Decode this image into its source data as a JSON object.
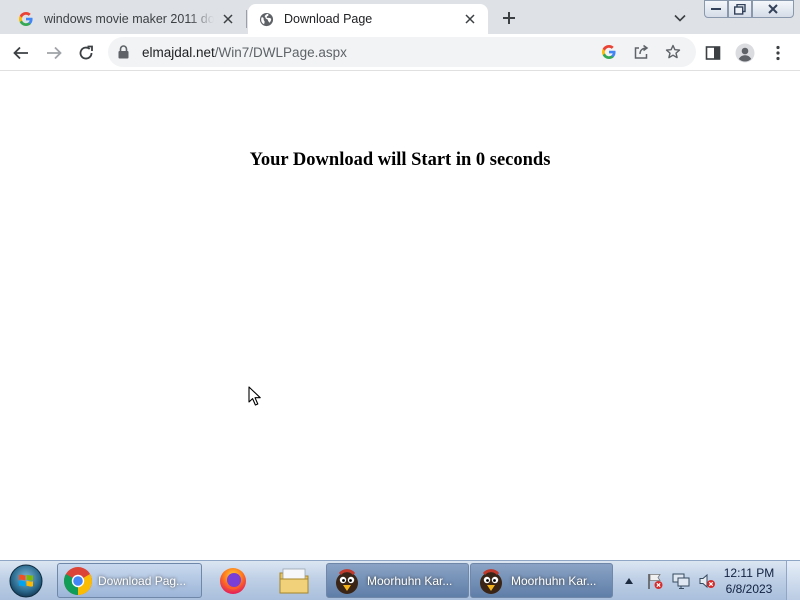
{
  "browser": {
    "tabs": [
      {
        "title": "windows movie maker 2011 dow",
        "favicon": "google-g-icon",
        "active": false
      },
      {
        "title": "Download Page",
        "favicon": "globe-icon",
        "active": true
      }
    ],
    "url": {
      "domain": "elmajdal.net",
      "path": "/Win7/DWLPage.aspx"
    }
  },
  "page": {
    "headline": "Your Download will Start in 0 seconds"
  },
  "taskbar": {
    "items": [
      {
        "label": "Download Pag...",
        "icon": "chrome-icon",
        "active": true
      },
      {
        "label": "Moorhuhn Kar...",
        "icon": "moorhuhn-icon",
        "active": false
      },
      {
        "label": "Moorhuhn Kar...",
        "icon": "moorhuhn-icon",
        "active": false
      }
    ],
    "pinned": [
      "firefox-icon",
      "file-explorer-icon"
    ],
    "clock": {
      "time": "12:11 PM",
      "date": "6/8/2023"
    }
  },
  "colors": {
    "tabstrip_bg": "#dee1e6",
    "omnibox_bg": "#f1f3f4",
    "taskbar_top": "#dce6f2",
    "taskbar_bottom": "#a9bfdc"
  }
}
